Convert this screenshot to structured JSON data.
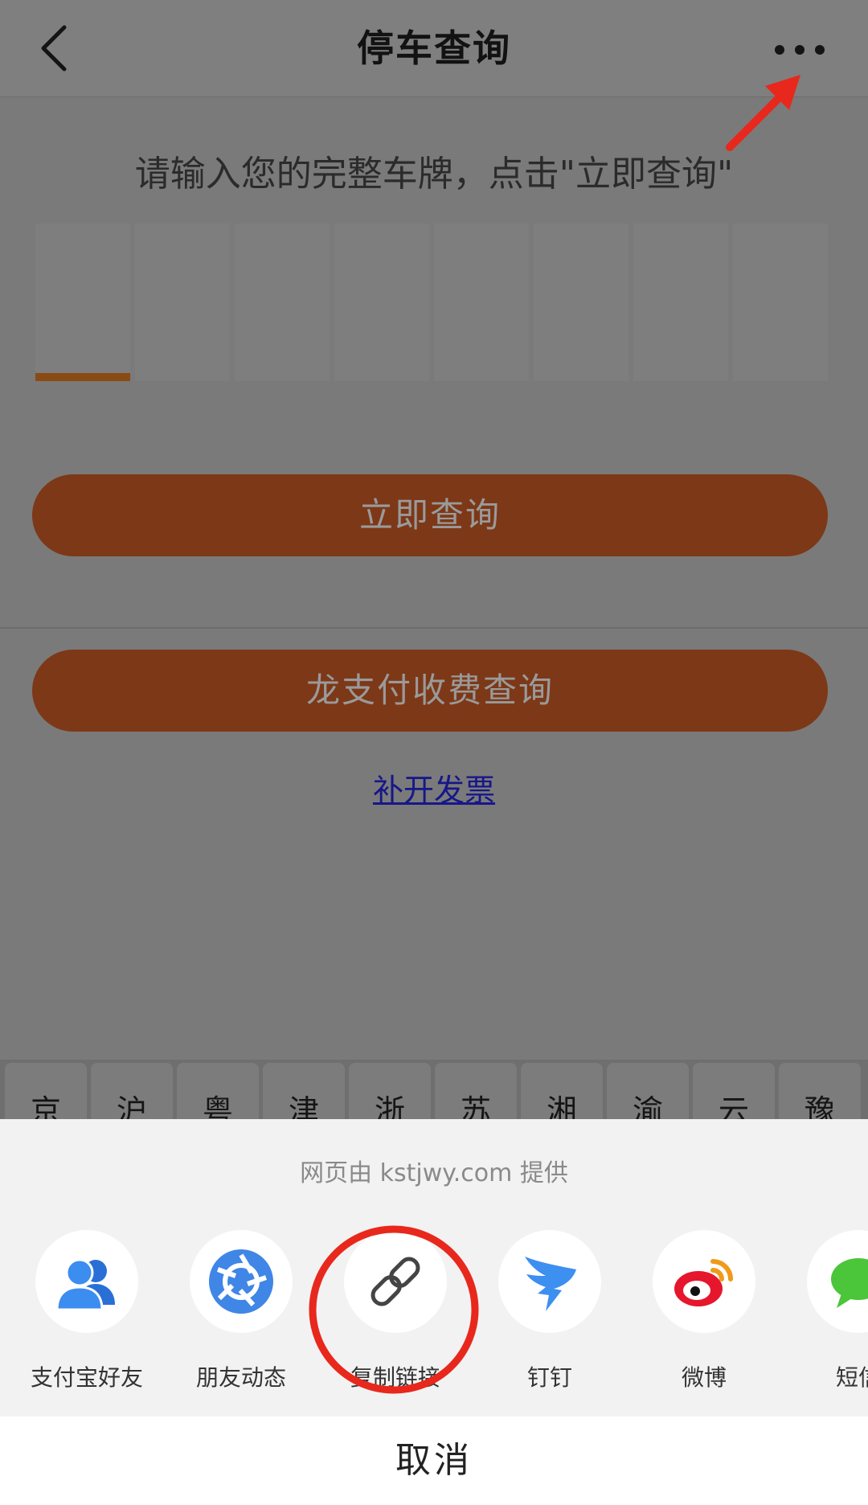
{
  "navbar": {
    "title": "停车查询",
    "back_icon": "chevron-left-icon",
    "more_icon": "ellipsis-icon"
  },
  "form": {
    "prompt": "请输入您的完整车牌，点击\"立即查询\"",
    "plate_box_count": 8,
    "active_box_index": 0,
    "query_button": "立即查询",
    "long_pay_button": "龙支付收费查询",
    "invoice_link": "补开发票"
  },
  "keyboard": {
    "keys": [
      "京",
      "沪",
      "粤",
      "津",
      "浙",
      "苏",
      "湘",
      "渝",
      "云",
      "豫"
    ]
  },
  "share": {
    "source_text": "网页由 kstjwy.com 提供",
    "items": [
      {
        "label": "支付宝好友",
        "icon": "alipay-friends-icon"
      },
      {
        "label": "朋友动态",
        "icon": "moments-icon"
      },
      {
        "label": "复制链接",
        "icon": "link-icon"
      },
      {
        "label": "钉钉",
        "icon": "dingtalk-icon"
      },
      {
        "label": "微博",
        "icon": "weibo-icon"
      },
      {
        "label": "短信",
        "icon": "sms-icon"
      }
    ],
    "cancel_label": "取消"
  },
  "colors": {
    "button_bg": "#7d3817",
    "annotation": "#e8281c",
    "link": "#17178a"
  }
}
